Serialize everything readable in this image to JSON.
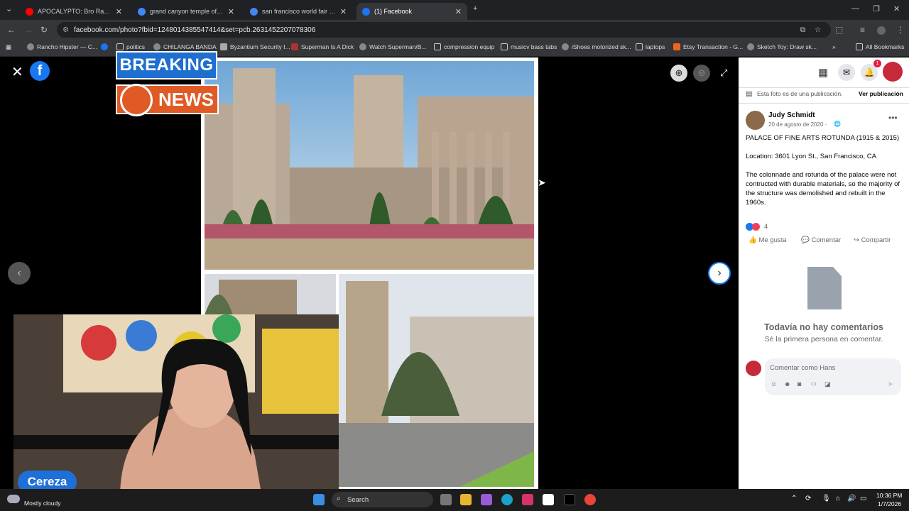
{
  "tabs": [
    {
      "title": "APOCALYPTO: Bro Ran for His L",
      "color": "#ff0000"
    },
    {
      "title": "grand canyon temple of isis - G",
      "color": "#4285f4"
    },
    {
      "title": "san francisco world fair 1915 - ",
      "color": "#4285f4"
    },
    {
      "title": "(1) Facebook",
      "color": "#1877f2"
    }
  ],
  "address": "facebook.com/photo?fbid=1248014385547414&set=pcb.2631452207078306",
  "bookmarks": [
    "Rancho Hipster — C...",
    "politics",
    "CHILANGA BANDA",
    "Byzantium Security I...",
    "Superman Is A Dick",
    "Watch Superman/B...",
    "compression equip",
    "musicv bass tabs",
    "iShoes motorized sk...",
    "laptops",
    "Etsy Transaction - G...",
    "Sketch Toy: Draw sk...",
    "All Bookmarks"
  ],
  "overlay": {
    "breaking": "BREAKING",
    "news": "NEWS",
    "streamer": "Cereza"
  },
  "side": {
    "notice": "Esta foto es de una publicación.",
    "see_post": "Ver publicación",
    "notif_count": "1",
    "author": "Judy Schmidt",
    "date": "20 de agosto de 2020 ·",
    "post_title": "PALACE OF FINE ARTS ROTUNDA (1915 & 2015)",
    "location": "Location: 3601 Lyon St., San Francisco, CA",
    "body": "The colonnade and rotunda of the palace were not contructed with durable materials, so the majority of the structure was demolished and rebuilt in the 1960s.",
    "reactions": "4",
    "like": "Me gusta",
    "comment": "Comentar",
    "share": "Compartir",
    "no_comments": "Todavía no hay comentarios",
    "first": "Sé la primera persona en comentar.",
    "comment_placeholder": "Comentar como Hans"
  },
  "taskbar": {
    "weather": "Mostly cloudy",
    "search": "Search",
    "time": "10:36 PM",
    "date": "1/7/2026"
  }
}
